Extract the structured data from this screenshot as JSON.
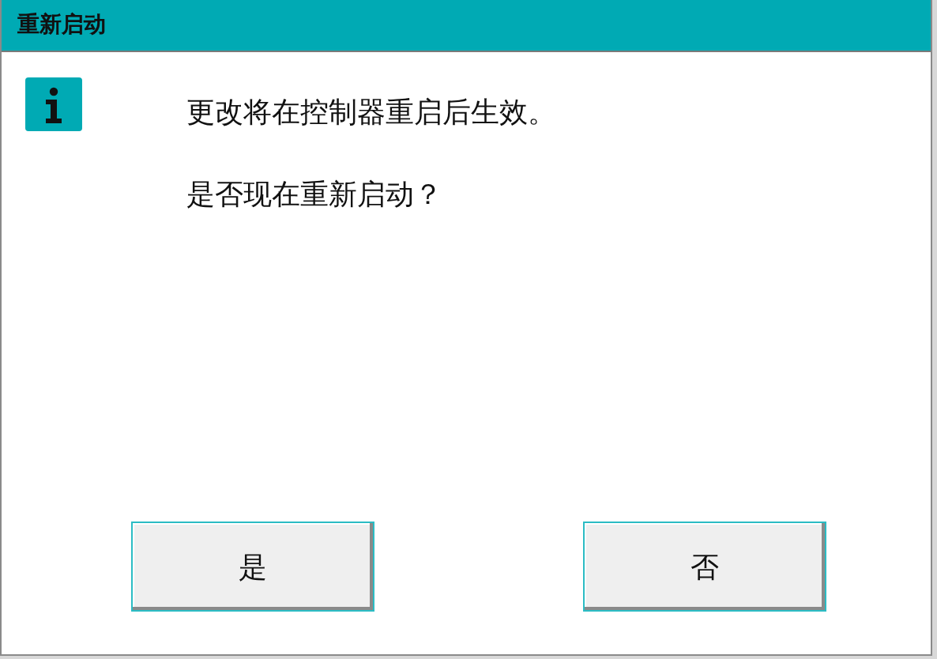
{
  "window": {
    "title": "重新启动"
  },
  "messages": [
    "更改将在控制器重启后生效。",
    "是否现在重新启动？"
  ],
  "buttons": [
    {
      "label": "是"
    },
    {
      "label": "否"
    }
  ]
}
